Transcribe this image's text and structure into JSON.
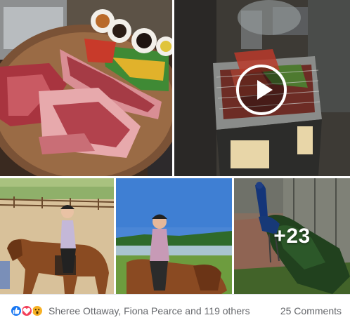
{
  "album": {
    "photos": [
      {
        "subject": "raw sliced beef platter with vegetables and sauces"
      },
      {
        "subject": "meat grilling on barbecue",
        "is_video": true
      },
      {
        "subject": "rider on brown horse in arena"
      },
      {
        "subject": "woman riding horse by lake"
      },
      {
        "subject": "peacock on pavement"
      }
    ],
    "more_photos_label": "+23",
    "play_icon": "play-icon"
  },
  "reactions": {
    "icons": [
      "like-icon",
      "love-icon",
      "wow-icon"
    ],
    "colors": {
      "like": "#1877f2",
      "love": "#f33e58",
      "wow": "#f7b125"
    },
    "summary": "Sheree Ottaway, Fiona Pearce and 119 others",
    "comments": "25 Comments"
  }
}
